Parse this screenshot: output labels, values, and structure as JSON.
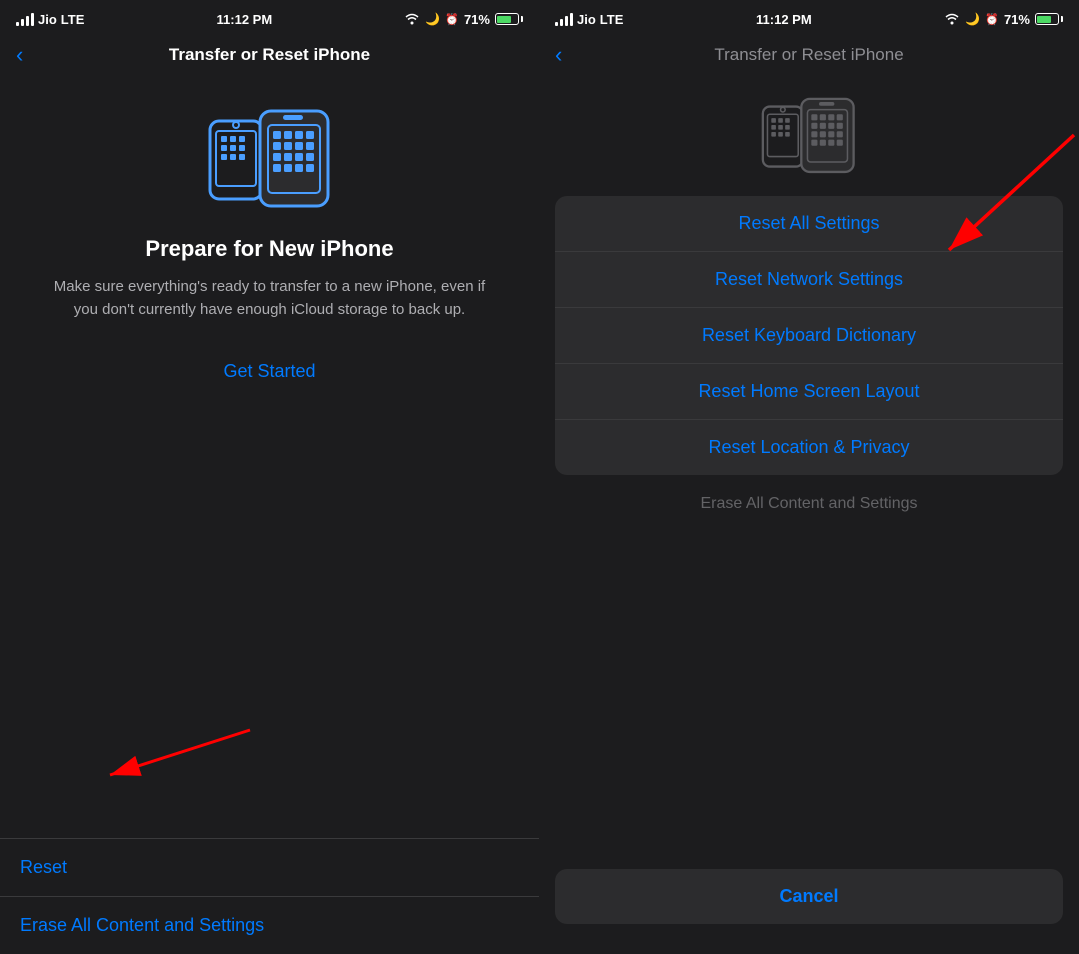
{
  "left": {
    "statusBar": {
      "carrier": "Jio",
      "network": "LTE",
      "time": "11:12 PM",
      "battery": "71%"
    },
    "navTitle": "Transfer or Reset iPhone",
    "icon": "transfer-phones",
    "prepareTitle": "Prepare for New iPhone",
    "prepareDesc": "Make sure everything's ready to transfer to a new iPhone, even if you don't currently have enough iCloud storage to back up.",
    "getStartedLabel": "Get Started",
    "resetLabel": "Reset",
    "eraseLabel": "Erase All Content and Settings"
  },
  "right": {
    "statusBar": {
      "carrier": "Jio",
      "network": "LTE",
      "time": "11:12 PM",
      "battery": "71%"
    },
    "navTitle": "Transfer or Reset iPhone",
    "resetItems": [
      "Reset All Settings",
      "Reset Network Settings",
      "Reset Keyboard Dictionary",
      "Reset Home Screen Layout",
      "Reset Location & Privacy"
    ],
    "eraseLabel": "Erase All Content and Settings",
    "cancelLabel": "Cancel"
  }
}
